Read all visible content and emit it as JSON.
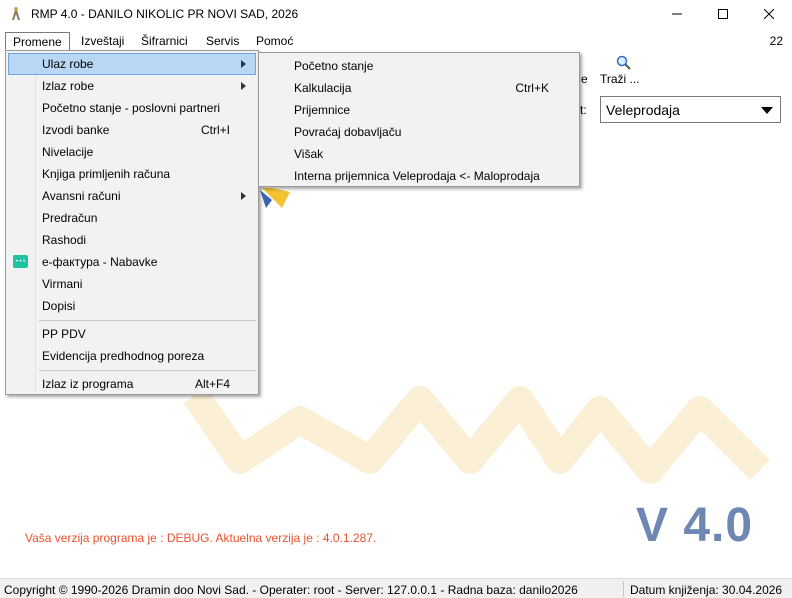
{
  "window": {
    "title": "RMP 4.0 - DANILO NIKOLIC PR NOVI SAD, 2026"
  },
  "menubar": {
    "items": [
      "Promene",
      "Izveštaji",
      "Šifrarnici",
      "Servis",
      "Pomoć"
    ],
    "right_number": "22"
  },
  "toolbar": {
    "search_label": "Traži ...",
    "partial_label": "e"
  },
  "combo": {
    "label_partial": "t:",
    "value": "Veleprodaja"
  },
  "promene_menu": {
    "items": [
      {
        "label": "Ulaz robe",
        "shortcut": "",
        "submenu": true
      },
      {
        "label": "Izlaz robe",
        "shortcut": "",
        "submenu": true
      },
      {
        "label": "Početno stanje - poslovni partneri",
        "shortcut": ""
      },
      {
        "label": "Izvodi banke",
        "shortcut": "Ctrl+I"
      },
      {
        "label": "Nivelacije",
        "shortcut": ""
      },
      {
        "label": "Knjiga primljenih računa",
        "shortcut": ""
      },
      {
        "label": "Avansni računi",
        "shortcut": "",
        "submenu": true
      },
      {
        "label": "Predračun",
        "shortcut": ""
      },
      {
        "label": "Rashodi",
        "shortcut": ""
      },
      {
        "label": "е-фактура - Nabavke",
        "shortcut": "",
        "icon": "e-invoice-icon"
      },
      {
        "label": "Virmani",
        "shortcut": ""
      },
      {
        "label": "Dopisi",
        "shortcut": ""
      },
      {
        "label": "PP PDV",
        "shortcut": ""
      },
      {
        "label": "Evidencija predhodnog poreza",
        "shortcut": ""
      },
      {
        "label": "Izlaz iz programa",
        "shortcut": "Alt+F4"
      }
    ]
  },
  "ulaz_robe_submenu": {
    "items": [
      {
        "label": "Početno stanje",
        "shortcut": ""
      },
      {
        "label": "Kalkulacija",
        "shortcut": "Ctrl+K"
      },
      {
        "label": "Prijemnice",
        "shortcut": ""
      },
      {
        "label": "Povraćaj dobavljaču",
        "shortcut": ""
      },
      {
        "label": "Višak",
        "shortcut": ""
      },
      {
        "label": "Interna prijemnica  Veleprodaja <- Maloprodaja",
        "shortcut": ""
      }
    ]
  },
  "background": {
    "version_big": "V 4.0",
    "version_text": "Vaša verzija programa je : DEBUG. Aktuelna verzija je : 4.0.1.287."
  },
  "statusbar": {
    "left": "Copyright © 1990-2026 Dramin doo Novi Sad. - Operater: root - Server: 127.0.0.1 - Radna baza: danilo2026",
    "right": "Datum knjiženja: 30.04.2026"
  },
  "colors": {
    "highlight": "#b9d7f5",
    "version_blue": "#6f87b3",
    "version_text": "#e8532f",
    "logo_watermark": "#fbf0d6"
  }
}
